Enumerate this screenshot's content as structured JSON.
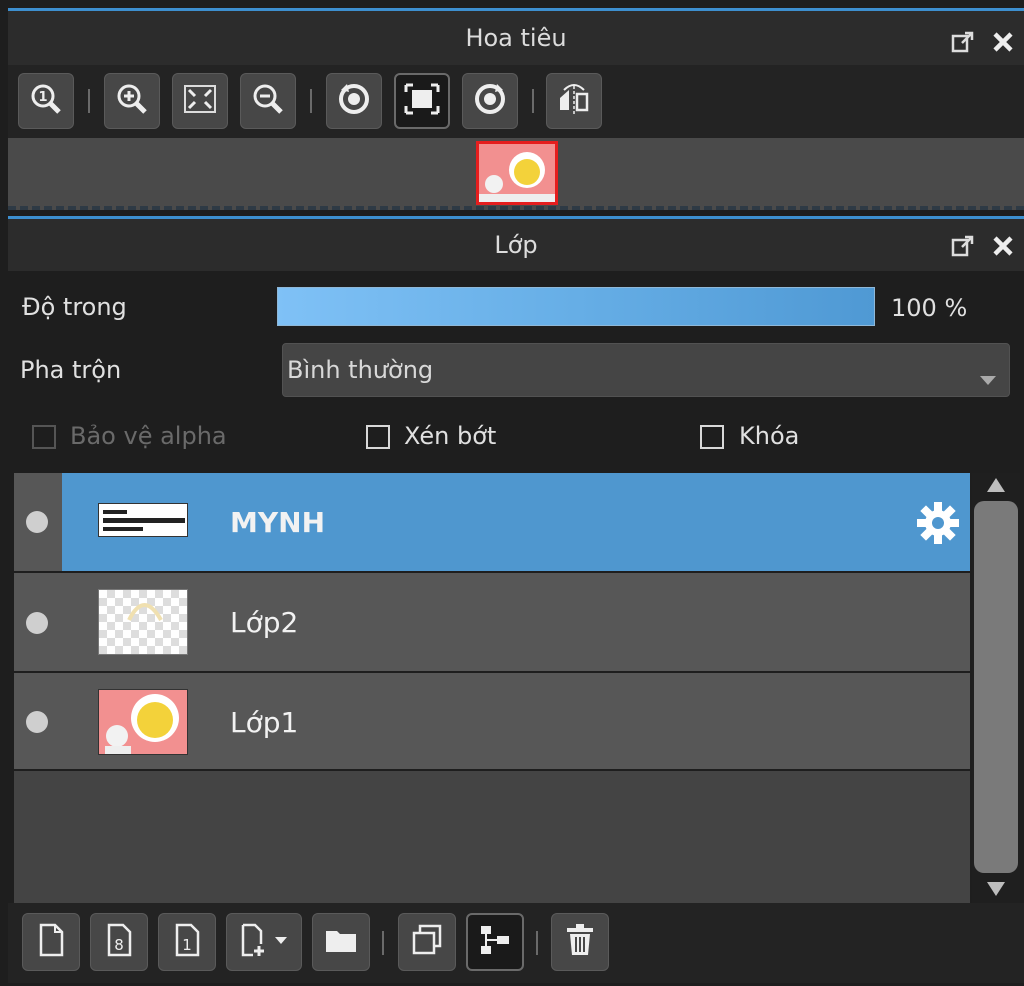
{
  "navigator": {
    "title": "Hoa tiêu",
    "toolbar_icons": [
      "zoom-actual-icon",
      "zoom-in-icon",
      "fit-screen-icon",
      "zoom-out-icon",
      "rotate-left-icon",
      "fit-canvas-icon",
      "rotate-right-icon",
      "flip-horizontal-icon"
    ]
  },
  "layers": {
    "title": "Lớp",
    "opacity_label": "Độ trong",
    "opacity_value": "100 %",
    "opacity_fraction": 1.0,
    "blend_label": "Pha trộn",
    "blend_value": "Bình thường",
    "checkboxes": {
      "protect_alpha": "Bảo vệ alpha",
      "clipping": "Xén bớt",
      "lock": "Khóa"
    },
    "items": [
      {
        "name": "MYNH",
        "selected": true
      },
      {
        "name": "Lớp2",
        "selected": false
      },
      {
        "name": "Lớp1",
        "selected": false
      }
    ],
    "bottom_icons": [
      "new-layer-icon",
      "new-8bit-layer-icon",
      "new-1bit-layer-icon",
      "add-layer-menu-icon",
      "new-folder-icon",
      "duplicate-layer-icon",
      "merge-down-icon",
      "delete-layer-icon"
    ]
  },
  "colors": {
    "accent": "#3d8fcf",
    "selected_row": "#4f97cf",
    "row_bg": "#575757"
  }
}
